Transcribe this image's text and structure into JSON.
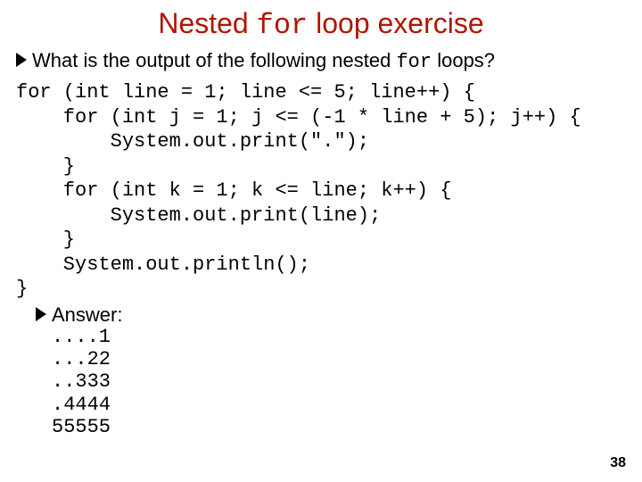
{
  "slide": {
    "title_pre": "Nested ",
    "title_code": "for",
    "title_post": " loop exercise",
    "bullet1_pre": "What is the output of the following nested ",
    "bullet1_code": "for",
    "bullet1_post": " loops?",
    "code": "for (int line = 1; line <= 5; line++) {\n    for (int j = 1; j <= (-1 * line + 5); j++) {\n        System.out.print(\".\");\n    }\n    for (int k = 1; k <= line; k++) {\n        System.out.print(line);\n    }\n    System.out.println();\n}",
    "answer_label": "Answer:",
    "answer_lines": "....1\n...22\n..333\n.4444\n55555",
    "page_number": "38"
  }
}
